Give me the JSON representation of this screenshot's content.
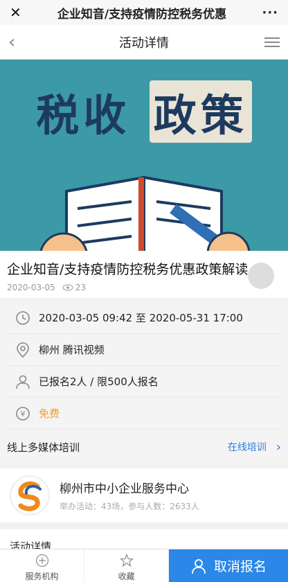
{
  "wechat_bar": {
    "title": "企业知音/支持疫情防控税务优惠"
  },
  "nav": {
    "title": "活动详情"
  },
  "banner": {
    "text_part1": "税收",
    "text_part2": "政策"
  },
  "activity": {
    "title": "企业知音/支持疫情防控税务优惠政策解读",
    "date": "2020-03-05",
    "views": "23"
  },
  "details": {
    "time": "2020-03-05 09:42 至 2020-05-31 17:00",
    "location": "柳州 腾讯视频",
    "signup": "已报名2人 / 限500人报名",
    "price": "免费",
    "training_type": "线上多媒体培训",
    "training_link": "在线培训"
  },
  "organizer": {
    "name": "柳州市中小企业服务中心",
    "stats": "举办活动：43场，参与人数：2633人"
  },
  "section": {
    "title": "活动详情"
  },
  "bottom": {
    "service_label": "服务机构",
    "favorite_label": "收藏",
    "cancel_label": "取消报名"
  },
  "colors": {
    "accent": "#2b87e8",
    "free": "#f0a020",
    "banner": "#3b9aa6"
  }
}
